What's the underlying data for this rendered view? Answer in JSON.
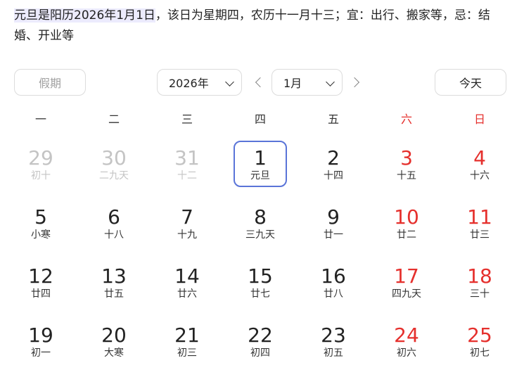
{
  "description": {
    "highlight": "元旦是阳历2026年1月1日",
    "rest": "，该日为星期四，农历十一月十三；宜：出行、搬家等，忌：结婚、开业等"
  },
  "toolbar": {
    "holiday_label": "假期",
    "year_value": "2026年",
    "month_value": "1月",
    "today_label": "今天"
  },
  "weekdays": [
    "一",
    "二",
    "三",
    "四",
    "五",
    "六",
    "日"
  ],
  "weeks": [
    [
      {
        "day": "29",
        "lunar": "初十",
        "state": "other"
      },
      {
        "day": "30",
        "lunar": "二九天",
        "state": "other"
      },
      {
        "day": "31",
        "lunar": "十二",
        "state": "other"
      },
      {
        "day": "1",
        "lunar": "元旦",
        "state": "today"
      },
      {
        "day": "2",
        "lunar": "十四",
        "state": "normal"
      },
      {
        "day": "3",
        "lunar": "十五",
        "state": "weekend"
      },
      {
        "day": "4",
        "lunar": "十六",
        "state": "weekend"
      }
    ],
    [
      {
        "day": "5",
        "lunar": "小寒",
        "state": "normal"
      },
      {
        "day": "6",
        "lunar": "十八",
        "state": "normal"
      },
      {
        "day": "7",
        "lunar": "十九",
        "state": "normal"
      },
      {
        "day": "8",
        "lunar": "三九天",
        "state": "normal"
      },
      {
        "day": "9",
        "lunar": "廿一",
        "state": "normal"
      },
      {
        "day": "10",
        "lunar": "廿二",
        "state": "weekend"
      },
      {
        "day": "11",
        "lunar": "廿三",
        "state": "weekend"
      }
    ],
    [
      {
        "day": "12",
        "lunar": "廿四",
        "state": "normal"
      },
      {
        "day": "13",
        "lunar": "廿五",
        "state": "normal"
      },
      {
        "day": "14",
        "lunar": "廿六",
        "state": "normal"
      },
      {
        "day": "15",
        "lunar": "廿七",
        "state": "normal"
      },
      {
        "day": "16",
        "lunar": "廿八",
        "state": "normal"
      },
      {
        "day": "17",
        "lunar": "四九天",
        "state": "weekend"
      },
      {
        "day": "18",
        "lunar": "三十",
        "state": "weekend"
      }
    ],
    [
      {
        "day": "19",
        "lunar": "初一",
        "state": "normal"
      },
      {
        "day": "20",
        "lunar": "大寒",
        "state": "normal"
      },
      {
        "day": "21",
        "lunar": "初三",
        "state": "normal"
      },
      {
        "day": "22",
        "lunar": "初四",
        "state": "normal"
      },
      {
        "day": "23",
        "lunar": "初五",
        "state": "normal"
      },
      {
        "day": "24",
        "lunar": "初六",
        "state": "weekend"
      },
      {
        "day": "25",
        "lunar": "初七",
        "state": "weekend"
      }
    ]
  ],
  "colors": {
    "weekend": "#e5302d",
    "today_border": "#5a74d8",
    "highlight_bg": "#ecebfd",
    "muted": "#c4c4c4"
  }
}
